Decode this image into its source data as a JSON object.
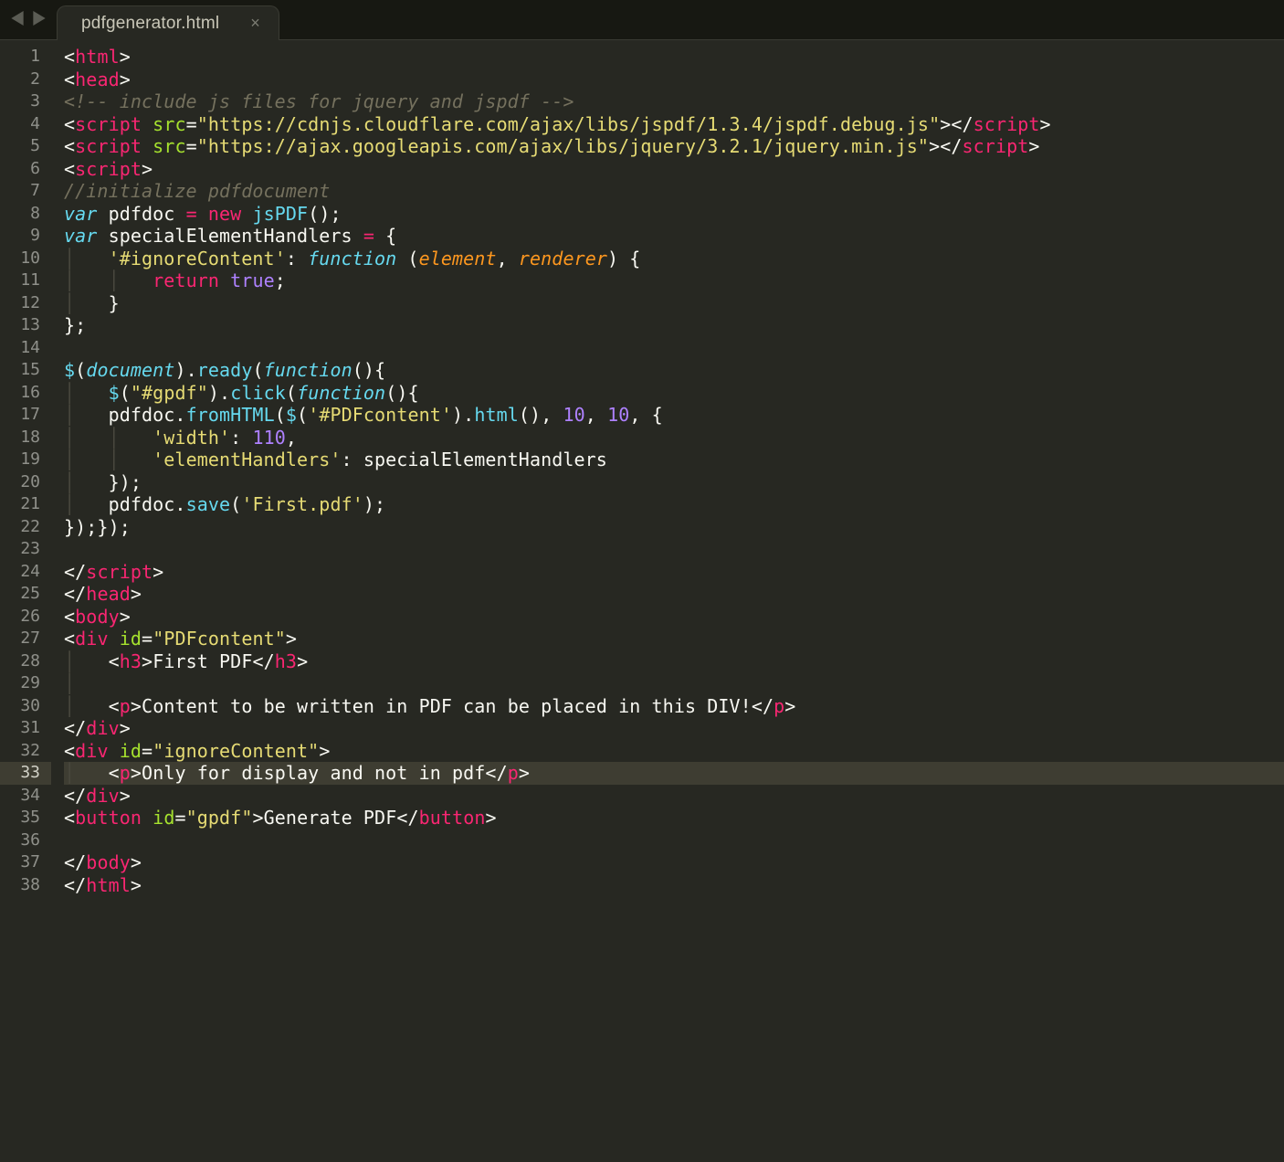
{
  "tab": {
    "title": "pdfgenerator.html",
    "close_glyph": "×"
  },
  "active_line": 33,
  "lines": [
    {
      "n": 1,
      "tokens": [
        [
          "p",
          "<"
        ],
        [
          "tg",
          "html"
        ],
        [
          "p",
          ">"
        ]
      ]
    },
    {
      "n": 2,
      "tokens": [
        [
          "p",
          "<"
        ],
        [
          "tg",
          "head"
        ],
        [
          "p",
          ">"
        ]
      ]
    },
    {
      "n": 3,
      "tokens": [
        [
          "cm",
          "<!-- include js files for jquery and jspdf -->"
        ]
      ]
    },
    {
      "n": 4,
      "tokens": [
        [
          "p",
          "<"
        ],
        [
          "tg",
          "script"
        ],
        [
          "p",
          " "
        ],
        [
          "at",
          "src"
        ],
        [
          "p",
          "="
        ],
        [
          "st",
          "\"https://cdnjs.cloudflare.com/ajax/libs/jspdf/1.3.4/jspdf.debug.js\""
        ],
        [
          "p",
          "></"
        ],
        [
          "tg",
          "script"
        ],
        [
          "p",
          ">"
        ]
      ]
    },
    {
      "n": 5,
      "tokens": [
        [
          "p",
          "<"
        ],
        [
          "tg",
          "script"
        ],
        [
          "p",
          " "
        ],
        [
          "at",
          "src"
        ],
        [
          "p",
          "="
        ],
        [
          "st",
          "\"https://ajax.googleapis.com/ajax/libs/jquery/3.2.1/jquery.min.js\""
        ],
        [
          "p",
          "></"
        ],
        [
          "tg",
          "script"
        ],
        [
          "p",
          ">"
        ]
      ]
    },
    {
      "n": 6,
      "tokens": [
        [
          "p",
          "<"
        ],
        [
          "tg",
          "script"
        ],
        [
          "p",
          ">"
        ]
      ]
    },
    {
      "n": 7,
      "tokens": [
        [
          "cm",
          "//initialize pdfdocument"
        ]
      ]
    },
    {
      "n": 8,
      "tokens": [
        [
          "kw",
          "var"
        ],
        [
          "p",
          " pdfdoc "
        ],
        [
          "op",
          "="
        ],
        [
          "p",
          " "
        ],
        [
          "op",
          "new"
        ],
        [
          "p",
          " "
        ],
        [
          "fn",
          "jsPDF"
        ],
        [
          "p",
          "();"
        ]
      ]
    },
    {
      "n": 9,
      "tokens": [
        [
          "kw",
          "var"
        ],
        [
          "p",
          " specialElementHandlers "
        ],
        [
          "op",
          "="
        ],
        [
          "p",
          " {"
        ]
      ]
    },
    {
      "n": 10,
      "tokens": [
        [
          "gd",
          "│   "
        ],
        [
          "st",
          "'#ignoreContent'"
        ],
        [
          "p",
          ": "
        ],
        [
          "fd",
          "function"
        ],
        [
          "p",
          " ("
        ],
        [
          "pa",
          "element"
        ],
        [
          "p",
          ", "
        ],
        [
          "pa",
          "renderer"
        ],
        [
          "p",
          ") {"
        ]
      ]
    },
    {
      "n": 11,
      "tokens": [
        [
          "gd",
          "│   │   "
        ],
        [
          "op",
          "return"
        ],
        [
          "p",
          " "
        ],
        [
          "cs",
          "true"
        ],
        [
          "p",
          ";"
        ]
      ]
    },
    {
      "n": 12,
      "tokens": [
        [
          "gd",
          "│   "
        ],
        [
          "p",
          "}"
        ]
      ]
    },
    {
      "n": 13,
      "tokens": [
        [
          "p",
          "};"
        ]
      ]
    },
    {
      "n": 14,
      "tokens": []
    },
    {
      "n": 15,
      "tokens": [
        [
          "fn",
          "$"
        ],
        [
          "p",
          "("
        ],
        [
          "kw",
          "document"
        ],
        [
          "p",
          ")."
        ],
        [
          "fn",
          "ready"
        ],
        [
          "p",
          "("
        ],
        [
          "fd",
          "function"
        ],
        [
          "p",
          "(){"
        ]
      ]
    },
    {
      "n": 16,
      "tokens": [
        [
          "gd",
          "│   "
        ],
        [
          "fn",
          "$"
        ],
        [
          "p",
          "("
        ],
        [
          "st",
          "\"#gpdf\""
        ],
        [
          "p",
          ")."
        ],
        [
          "fn",
          "click"
        ],
        [
          "p",
          "("
        ],
        [
          "fd",
          "function"
        ],
        [
          "p",
          "(){"
        ]
      ]
    },
    {
      "n": 17,
      "tokens": [
        [
          "gd",
          "│   "
        ],
        [
          "p",
          "pdfdoc."
        ],
        [
          "fn",
          "fromHTML"
        ],
        [
          "p",
          "("
        ],
        [
          "fn",
          "$"
        ],
        [
          "p",
          "("
        ],
        [
          "st",
          "'#PDFcontent'"
        ],
        [
          "p",
          ")."
        ],
        [
          "fn",
          "html"
        ],
        [
          "p",
          "(), "
        ],
        [
          "nm",
          "10"
        ],
        [
          "p",
          ", "
        ],
        [
          "nm",
          "10"
        ],
        [
          "p",
          ", {"
        ]
      ]
    },
    {
      "n": 18,
      "tokens": [
        [
          "gd",
          "│   │   "
        ],
        [
          "st",
          "'width'"
        ],
        [
          "p",
          ": "
        ],
        [
          "nm",
          "110"
        ],
        [
          "p",
          ","
        ]
      ]
    },
    {
      "n": 19,
      "tokens": [
        [
          "gd",
          "│   │   "
        ],
        [
          "st",
          "'elementHandlers'"
        ],
        [
          "p",
          ": specialElementHandlers"
        ]
      ]
    },
    {
      "n": 20,
      "tokens": [
        [
          "gd",
          "│   "
        ],
        [
          "p",
          "});"
        ]
      ]
    },
    {
      "n": 21,
      "tokens": [
        [
          "gd",
          "│   "
        ],
        [
          "p",
          "pdfdoc."
        ],
        [
          "fn",
          "save"
        ],
        [
          "p",
          "("
        ],
        [
          "st",
          "'First.pdf'"
        ],
        [
          "p",
          ");"
        ]
      ]
    },
    {
      "n": 22,
      "tokens": [
        [
          "p",
          "});});"
        ]
      ]
    },
    {
      "n": 23,
      "tokens": []
    },
    {
      "n": 24,
      "tokens": [
        [
          "p",
          "</"
        ],
        [
          "tg",
          "script"
        ],
        [
          "p",
          ">"
        ]
      ]
    },
    {
      "n": 25,
      "tokens": [
        [
          "p",
          "</"
        ],
        [
          "tg",
          "head"
        ],
        [
          "p",
          ">"
        ]
      ]
    },
    {
      "n": 26,
      "tokens": [
        [
          "p",
          "<"
        ],
        [
          "tg",
          "body"
        ],
        [
          "p",
          ">"
        ]
      ]
    },
    {
      "n": 27,
      "tokens": [
        [
          "p",
          "<"
        ],
        [
          "tg",
          "div"
        ],
        [
          "p",
          " "
        ],
        [
          "at",
          "id"
        ],
        [
          "p",
          "="
        ],
        [
          "st",
          "\"PDFcontent\""
        ],
        [
          "p",
          ">"
        ]
      ]
    },
    {
      "n": 28,
      "tokens": [
        [
          "gd",
          "│   "
        ],
        [
          "p",
          "<"
        ],
        [
          "tg",
          "h3"
        ],
        [
          "p",
          ">"
        ],
        [
          "p",
          "First PDF"
        ],
        [
          "p",
          "</"
        ],
        [
          "tg",
          "h3"
        ],
        [
          "p",
          ">"
        ]
      ]
    },
    {
      "n": 29,
      "tokens": [
        [
          "gd",
          "│"
        ]
      ]
    },
    {
      "n": 30,
      "tokens": [
        [
          "gd",
          "│   "
        ],
        [
          "p",
          "<"
        ],
        [
          "tg",
          "p"
        ],
        [
          "p",
          ">"
        ],
        [
          "p",
          "Content to be written in PDF can be placed in this DIV!"
        ],
        [
          "p",
          "</"
        ],
        [
          "tg",
          "p"
        ],
        [
          "p",
          ">"
        ]
      ]
    },
    {
      "n": 31,
      "tokens": [
        [
          "p",
          "</"
        ],
        [
          "tg",
          "div"
        ],
        [
          "p",
          ">"
        ]
      ]
    },
    {
      "n": 32,
      "tokens": [
        [
          "p",
          "<"
        ],
        [
          "tg",
          "div"
        ],
        [
          "p",
          " "
        ],
        [
          "at",
          "id"
        ],
        [
          "p",
          "="
        ],
        [
          "st",
          "\"ignoreContent\""
        ],
        [
          "p",
          ">"
        ]
      ]
    },
    {
      "n": 33,
      "tokens": [
        [
          "gd",
          "│   "
        ],
        [
          "p",
          "<"
        ],
        [
          "tg",
          "p"
        ],
        [
          "p",
          ">"
        ],
        [
          "p",
          "Only for display and not in pdf"
        ],
        [
          "p",
          "</"
        ],
        [
          "tg",
          "p"
        ],
        [
          "p",
          ">"
        ]
      ]
    },
    {
      "n": 34,
      "tokens": [
        [
          "p",
          "</"
        ],
        [
          "tg",
          "div"
        ],
        [
          "p",
          ">"
        ]
      ]
    },
    {
      "n": 35,
      "tokens": [
        [
          "p",
          "<"
        ],
        [
          "tg",
          "button"
        ],
        [
          "p",
          " "
        ],
        [
          "at",
          "id"
        ],
        [
          "p",
          "="
        ],
        [
          "st",
          "\"gpdf\""
        ],
        [
          "p",
          ">"
        ],
        [
          "p",
          "Generate PDF"
        ],
        [
          "p",
          "</"
        ],
        [
          "tg",
          "button"
        ],
        [
          "p",
          ">"
        ]
      ]
    },
    {
      "n": 36,
      "tokens": []
    },
    {
      "n": 37,
      "tokens": [
        [
          "p",
          "</"
        ],
        [
          "tg",
          "body"
        ],
        [
          "p",
          ">"
        ]
      ]
    },
    {
      "n": 38,
      "tokens": [
        [
          "p",
          "</"
        ],
        [
          "tg",
          "html"
        ],
        [
          "p",
          ">"
        ]
      ]
    }
  ]
}
